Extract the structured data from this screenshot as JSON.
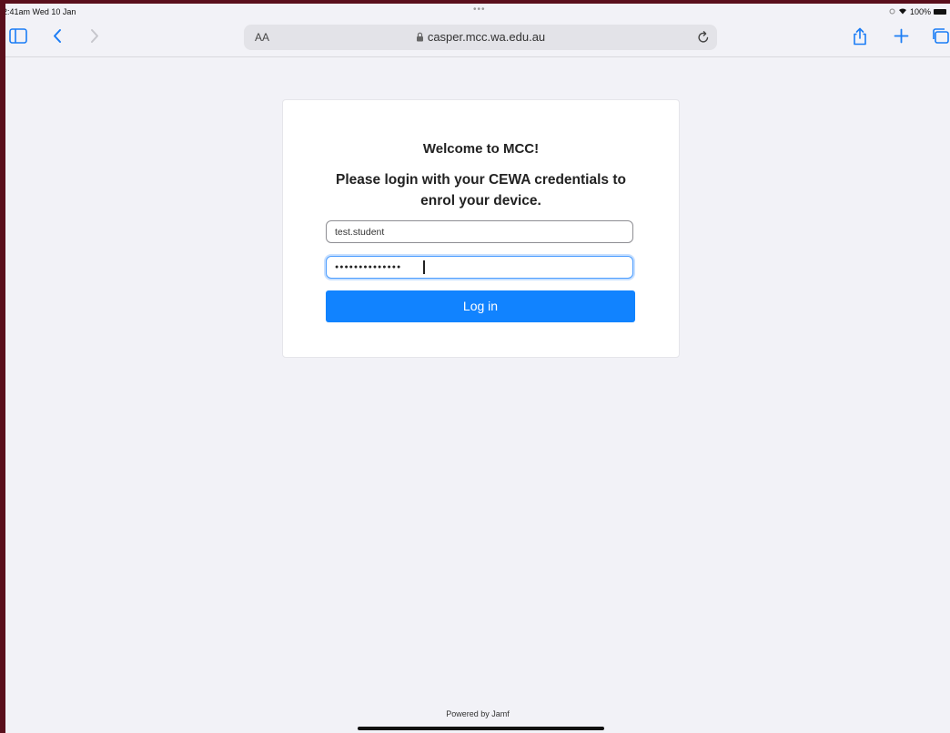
{
  "statusbar": {
    "time": "2:41am  Wed 10 Jan",
    "dots": "•••",
    "battery_text": "100%"
  },
  "browser": {
    "text_size_label": "AA",
    "url": "casper.mcc.wa.edu.au",
    "icons": [
      "sidebar-icon",
      "back-icon",
      "forward-icon",
      "lock-icon",
      "reload-icon",
      "share-icon",
      "new-tab-icon",
      "tabs-icon"
    ]
  },
  "login": {
    "welcome": "Welcome to MCC!",
    "instructions": "Please login with your CEWA credentials to enrol your device.",
    "username_value": "test.student",
    "password_masked": "●●●●●●●●●●●●●●",
    "login_label": "Log in"
  },
  "footer": {
    "powered_by": "Powered by Jamf"
  },
  "colors": {
    "accent": "#1183ff",
    "page_background": "#f2f2f7",
    "frame": "#5a0f1c"
  }
}
